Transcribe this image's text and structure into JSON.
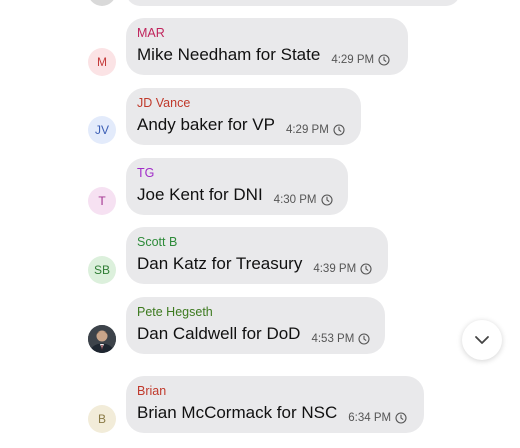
{
  "colors": {
    "bubble": "#e9e9eb",
    "text": "#111111",
    "time": "#555555"
  },
  "messages": [
    {
      "sender": "MAR",
      "sender_color": "#c0245c",
      "avatar_initials": "M",
      "avatar_bg": "#fbe3e5",
      "avatar_fg": "#c43a3a",
      "text": "Mike Needham for State",
      "time": "4:29 PM"
    },
    {
      "sender": "JD Vance",
      "sender_color": "#c0392b",
      "avatar_initials": "JV",
      "avatar_bg": "#e3ebfb",
      "avatar_fg": "#3b5eb5",
      "text": "Andy baker for VP",
      "time": "4:29 PM"
    },
    {
      "sender": "TG",
      "sender_color": "#a12dc8",
      "avatar_initials": "T",
      "avatar_bg": "#f6e1f2",
      "avatar_fg": "#a1328f",
      "text": "Joe Kent for DNI",
      "time": "4:30 PM"
    },
    {
      "sender": "Scott B",
      "sender_color": "#2e8b3a",
      "avatar_initials": "SB",
      "avatar_bg": "#dcf0dc",
      "avatar_fg": "#2f7d34",
      "text": "Dan Katz for Treasury",
      "time": "4:39 PM"
    },
    {
      "sender": "Pete Hegseth",
      "sender_color": "#3d7a1f",
      "avatar_initials": "",
      "avatar_bg": "#4a5058",
      "avatar_fg": "#ffffff",
      "text": "Dan Caldwell for DoD",
      "time": "4:53 PM"
    },
    {
      "sender": "Brian",
      "sender_color": "#c0392b",
      "avatar_initials": "B",
      "avatar_bg": "#f2ecd9",
      "avatar_fg": "#8a7a45",
      "text": "Brian McCormack for NSC",
      "time": "6:34 PM"
    }
  ],
  "icons": {
    "clock": "clock-icon",
    "scroll": "chevron-down-icon",
    "photo": "profile-photo"
  }
}
